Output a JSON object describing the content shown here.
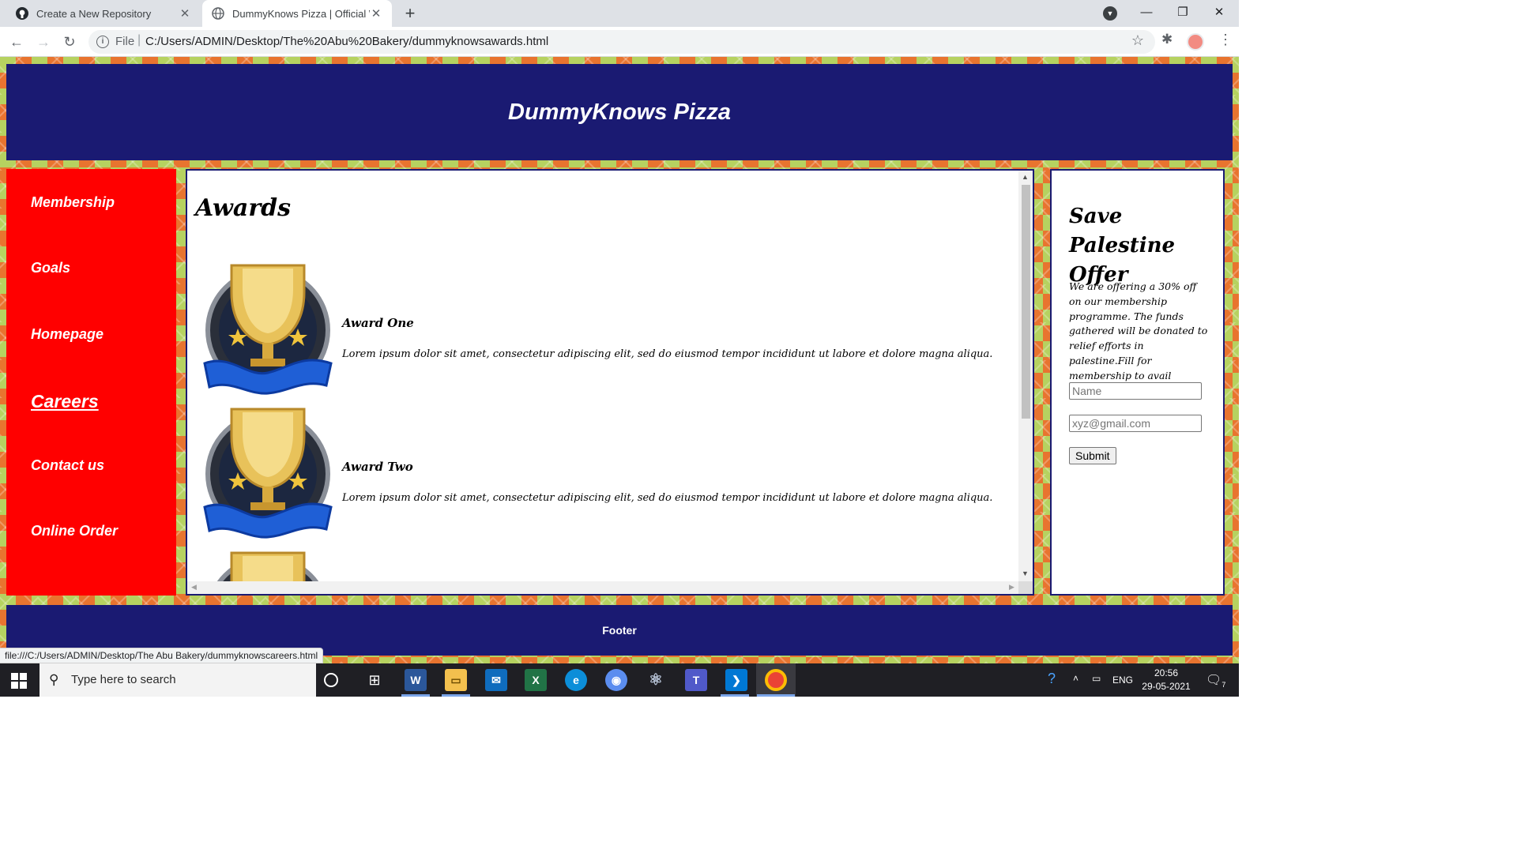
{
  "browser": {
    "tabs": [
      {
        "title": "Create a New Repository",
        "active": false
      },
      {
        "title": "DummyKnows Pizza | Official We",
        "active": true
      }
    ],
    "omnibox": {
      "scheme_label": "File",
      "url": "C:/Users/ADMIN/Desktop/The%20Abu%20Bakery/dummyknowsawards.html"
    },
    "status_url": "file:///C:/Users/ADMIN/Desktop/The Abu Bakery/dummyknowscareers.html"
  },
  "site": {
    "title": "DummyKnows Pizza",
    "nav": [
      {
        "label": "Membership"
      },
      {
        "label": "Goals"
      },
      {
        "label": "Homepage"
      },
      {
        "label": "Careers",
        "hovered": true
      },
      {
        "label": "Contact us"
      },
      {
        "label": "Online Order"
      }
    ],
    "main": {
      "heading": "Awards",
      "awards": [
        {
          "title": "Award One",
          "text": "Lorem ipsum dolor sit amet, consectetur adipiscing elit, sed do eiusmod tempor incididunt ut labore et dolore magna aliqua."
        },
        {
          "title": "Award Two",
          "text": "Lorem ipsum dolor sit amet, consectetur adipiscing elit, sed do eiusmod tempor incididunt ut labore et dolore magna aliqua."
        }
      ]
    },
    "offer": {
      "title": "Save Palestine Offer",
      "text": "We are offering a 30% off on our membership programme. The funds gathered will be donated to relief efforts in palestine.Fill for membership to avail special discounts!!",
      "name_placeholder": "Name",
      "email_placeholder": "xyz@gmail.com",
      "submit_label": "Submit"
    },
    "footer": "Footer"
  },
  "taskbar": {
    "search_placeholder": "Type here to search",
    "language": "ENG",
    "time": "20:56",
    "date": "29-05-2021",
    "notification_count": "7"
  },
  "colors": {
    "header_bg": "#1a1a72",
    "nav_bg": "#ff0000",
    "page_pattern_green": "#b6d260",
    "page_pattern_orange": "#e8742f"
  }
}
